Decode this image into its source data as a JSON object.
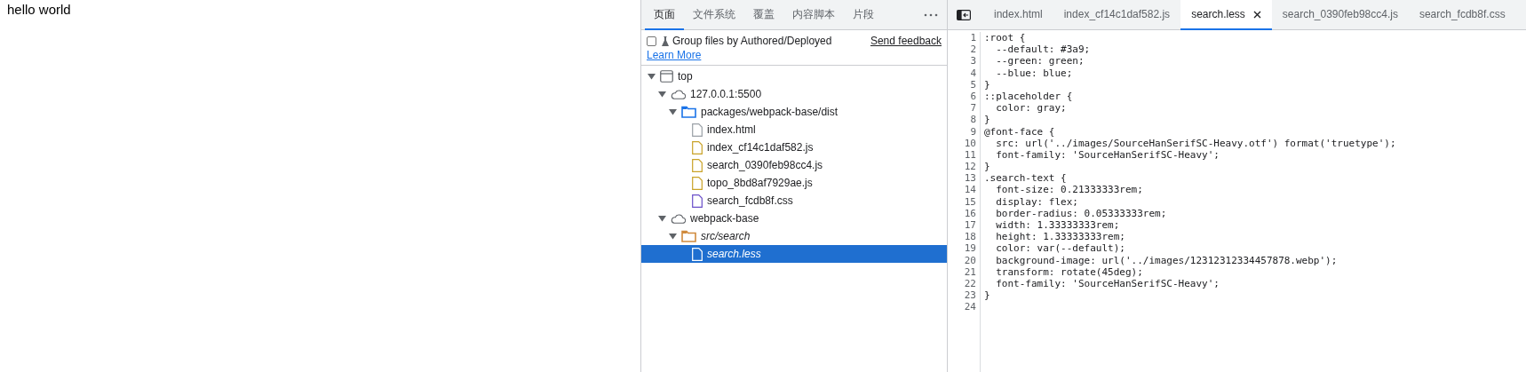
{
  "page": {
    "text": "hello world"
  },
  "navigator": {
    "tabs": [
      {
        "label": "页面",
        "selected": true
      },
      {
        "label": "文件系统",
        "selected": false
      },
      {
        "label": "覆盖",
        "selected": false
      },
      {
        "label": "内容脚本",
        "selected": false
      },
      {
        "label": "片段",
        "selected": false
      }
    ],
    "group_option": {
      "label": "Group files by Authored/Deployed",
      "checked": false
    },
    "feedback_link": "Send feedback",
    "learn_more_link": "Learn More",
    "tree": [
      {
        "kind": "frame",
        "label": "top",
        "expanded": true,
        "selected": false,
        "mapped": false,
        "children": [
          {
            "kind": "origin",
            "label": "127.0.0.1:5500",
            "expanded": true,
            "selected": false,
            "mapped": false,
            "children": [
              {
                "kind": "folder",
                "label": "packages/webpack-base/dist",
                "color": "#1a73e8",
                "expanded": true,
                "selected": false,
                "mapped": false,
                "children": [
                  {
                    "kind": "file",
                    "label": "index.html",
                    "color": "#9aa0a6",
                    "selected": false,
                    "mapped": false
                  },
                  {
                    "kind": "file",
                    "label": "index_cf14c1daf582.js",
                    "color": "#c9a227",
                    "selected": false,
                    "mapped": false
                  },
                  {
                    "kind": "file",
                    "label": "search_0390feb98cc4.js",
                    "color": "#c9a227",
                    "selected": false,
                    "mapped": false
                  },
                  {
                    "kind": "file",
                    "label": "topo_8bd8af7929ae.js",
                    "color": "#c9a227",
                    "selected": false,
                    "mapped": false
                  },
                  {
                    "kind": "file",
                    "label": "search_fcdb8f.css",
                    "color": "#6a4fc9",
                    "selected": false,
                    "mapped": false
                  }
                ]
              }
            ]
          },
          {
            "kind": "origin",
            "label": "webpack-base",
            "expanded": true,
            "selected": false,
            "mapped": false,
            "children": [
              {
                "kind": "folder",
                "label": "src/search",
                "color": "#d08a3c",
                "expanded": true,
                "selected": false,
                "mapped": true,
                "children": [
                  {
                    "kind": "file",
                    "label": "search.less",
                    "selected": true,
                    "mapped": true
                  }
                ]
              }
            ]
          }
        ]
      }
    ]
  },
  "editor": {
    "tabs": [
      {
        "label": "index.html",
        "selected": false
      },
      {
        "label": "index_cf14c1daf582.js",
        "selected": false
      },
      {
        "label": "search.less",
        "selected": true
      },
      {
        "label": "search_0390feb98cc4.js",
        "selected": false
      },
      {
        "label": "search_fcdb8f.css",
        "selected": false
      }
    ],
    "lines": [
      {
        "number": "1",
        "text": ":root {"
      },
      {
        "number": "2",
        "text": "  --default: #3a9;"
      },
      {
        "number": "3",
        "text": "  --green: green;"
      },
      {
        "number": "4",
        "text": "  --blue: blue;"
      },
      {
        "number": "5",
        "text": "}"
      },
      {
        "number": "6",
        "text": "::placeholder {"
      },
      {
        "number": "7",
        "text": "  color: gray;"
      },
      {
        "number": "8",
        "text": "}"
      },
      {
        "number": "9",
        "text": "@font-face {"
      },
      {
        "number": "10",
        "text": "  src: url('../images/SourceHanSerifSC-Heavy.otf') format('truetype');"
      },
      {
        "number": "11",
        "text": "  font-family: 'SourceHanSerifSC-Heavy';"
      },
      {
        "number": "12",
        "text": "}"
      },
      {
        "number": "13",
        "text": ".search-text {"
      },
      {
        "number": "14",
        "text": "  font-size: 0.21333333rem;"
      },
      {
        "number": "15",
        "text": "  display: flex;"
      },
      {
        "number": "16",
        "text": "  border-radius: 0.05333333rem;"
      },
      {
        "number": "17",
        "text": "  width: 1.33333333rem;"
      },
      {
        "number": "18",
        "text": "  height: 1.33333333rem;"
      },
      {
        "number": "19",
        "text": "  color: var(--default);"
      },
      {
        "number": "20",
        "text": "  background-image: url('../images/12312312334457878.webp');"
      },
      {
        "number": "21",
        "text": "  transform: rotate(45deg);"
      },
      {
        "number": "22",
        "text": "  font-family: 'SourceHanSerifSC-Heavy';"
      },
      {
        "number": "23",
        "text": "}"
      },
      {
        "number": "24"
      }
    ]
  }
}
